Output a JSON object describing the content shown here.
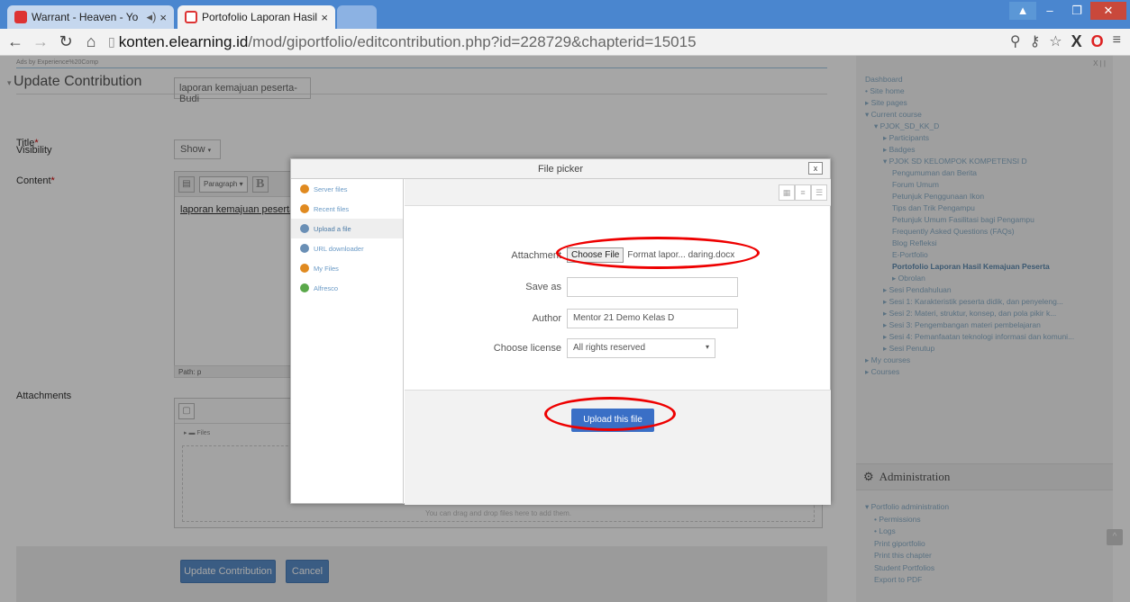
{
  "browser": {
    "tabs": [
      {
        "title": "Warrant - Heaven - Yo",
        "close": "×"
      },
      {
        "title": "Portofolio Laporan Hasil K",
        "close": "×"
      }
    ],
    "url_domain": "konten.elearning.id",
    "url_path": "/mod/giportfolio/editcontribution.php?id=228729&chapterid=15015"
  },
  "page": {
    "ads_text": "Ads by Experience%20Comp",
    "heading": "Update Contribution",
    "title_label": "Title",
    "title_value": "laporan kemajuan peserta-Budi",
    "visibility_label": "Visibility",
    "visibility_value": "Show",
    "content_label": "Content",
    "editor_format": "Paragraph",
    "editor_text": "laporan kemajuan peserta-B",
    "path_text": "Path: p",
    "attachments_label": "Attachments",
    "files_label": "Files",
    "drop_hint": "You can drag and drop files here to add them.",
    "update_button": "Update Contribution",
    "cancel_button": "Cancel"
  },
  "sidebar": {
    "close_mark": "X | |",
    "tree": [
      {
        "label": "Dashboard",
        "indent": 0
      },
      {
        "label": "• Site home",
        "indent": 0
      },
      {
        "label": "▸ Site pages",
        "indent": 0
      },
      {
        "label": "▾ Current course",
        "indent": 0
      },
      {
        "label": "▾ PJOK_SD_KK_D",
        "indent": 1
      },
      {
        "label": "▸ Participants",
        "indent": 2
      },
      {
        "label": "▸ Badges",
        "indent": 2
      },
      {
        "label": "▾ PJOK SD KELOMPOK KOMPETENSI D",
        "indent": 2
      },
      {
        "label": "Pengumuman dan Berita",
        "indent": 3
      },
      {
        "label": "Forum Umum",
        "indent": 3
      },
      {
        "label": "Petunjuk Penggunaan Ikon",
        "indent": 3
      },
      {
        "label": "Tips dan Trik Pengampu",
        "indent": 3
      },
      {
        "label": "Petunjuk Umum Fasilitasi bagi Pengampu",
        "indent": 3
      },
      {
        "label": "Frequently Asked Questions (FAQs)",
        "indent": 3
      },
      {
        "label": "Blog Refleksi",
        "indent": 3
      },
      {
        "label": "E-Portfolio",
        "indent": 3
      },
      {
        "label": "Portofolio Laporan Hasil Kemajuan Peserta",
        "indent": 3
      },
      {
        "label": "▸ Obrolan",
        "indent": 3
      },
      {
        "label": "▸ Sesi Pendahuluan",
        "indent": 2
      },
      {
        "label": "▸ Sesi 1: Karakteristik peserta didik, dan penyeleng...",
        "indent": 2
      },
      {
        "label": "▸ Sesi 2: Materi, struktur, konsep, dan pola pikir k...",
        "indent": 2
      },
      {
        "label": "▸ Sesi 3: Pengembangan materi pembelajaran",
        "indent": 2
      },
      {
        "label": "▸ Sesi 4: Pemanfaatan teknologi informasi dan komuni...",
        "indent": 2
      },
      {
        "label": "▸ Sesi Penutup",
        "indent": 2
      },
      {
        "label": "▸ My courses",
        "indent": 0
      },
      {
        "label": "▸ Courses",
        "indent": 0
      }
    ],
    "admin_title": "Administration",
    "admin_items": [
      "▾ Portfolio administration",
      "• Permissions",
      "• Logs",
      "Print giportfolio",
      "Print this chapter",
      "Student Portfolios",
      "Export to PDF"
    ]
  },
  "dialog": {
    "title": "File picker",
    "close": "x",
    "repos": [
      {
        "label": "Server files",
        "color": "#e08a20"
      },
      {
        "label": "Recent files",
        "color": "#e08a20"
      },
      {
        "label": "Upload a file",
        "color": "#6a8fb5"
      },
      {
        "label": "URL downloader",
        "color": "#6a8fb5"
      },
      {
        "label": "My Files",
        "color": "#e08a20"
      },
      {
        "label": "Alfresco",
        "color": "#5aa84a"
      }
    ],
    "attachment_label": "Attachment",
    "choose_file": "Choose File",
    "file_name": "Format lapor... daring.docx",
    "save_as_label": "Save as",
    "author_label": "Author",
    "author_value": "Mentor 21 Demo Kelas D",
    "license_label": "Choose license",
    "license_value": "All rights reserved",
    "upload_button": "Upload this file"
  }
}
